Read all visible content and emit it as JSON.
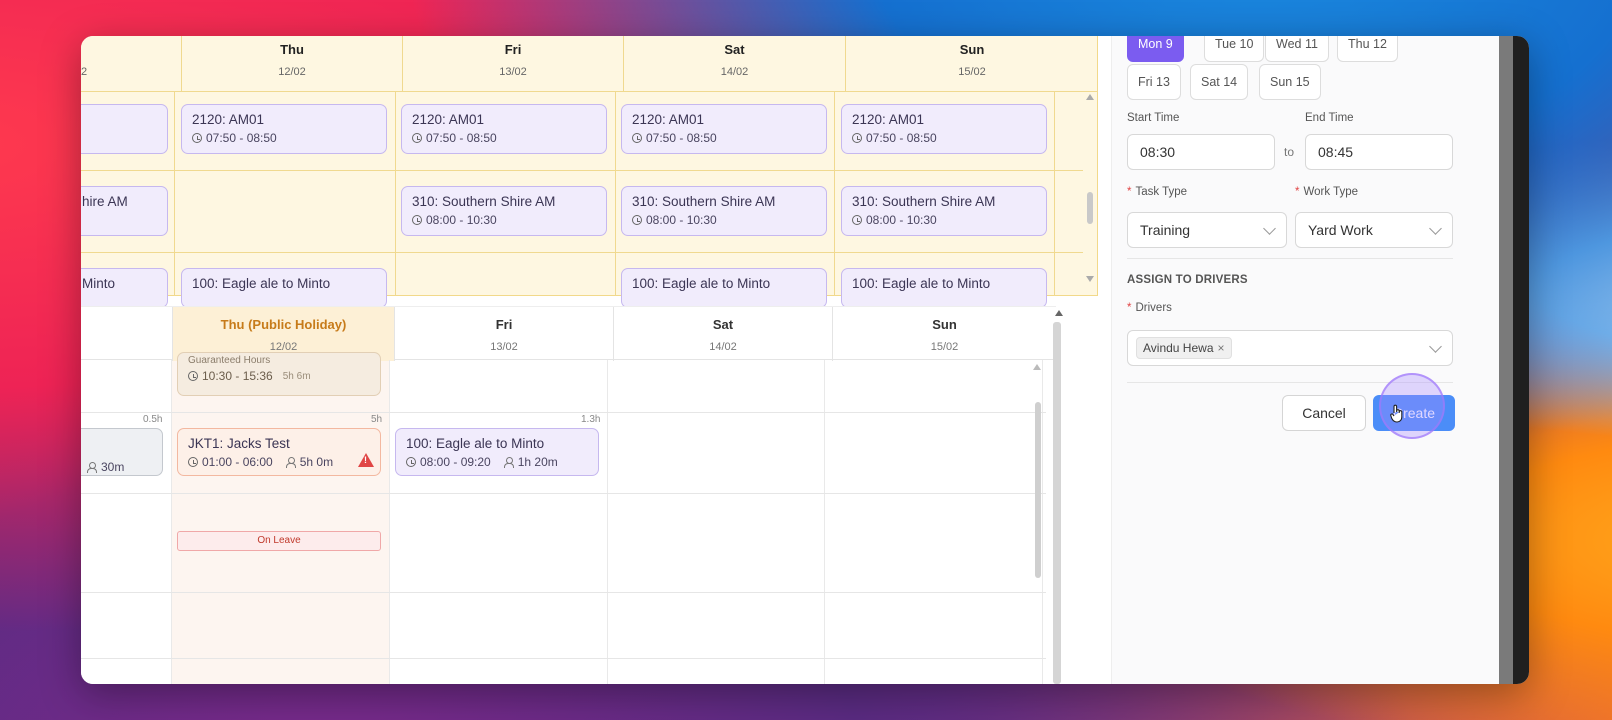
{
  "top_schedule": {
    "days": [
      {
        "name": "Thu",
        "date": "12/02"
      },
      {
        "name": "Fri",
        "date": "13/02"
      },
      {
        "name": "Sat",
        "date": "14/02"
      },
      {
        "name": "Sun",
        "date": "15/02"
      }
    ],
    "cut_date": "2",
    "row1": {
      "title": "2120: AM01",
      "time": "07:50 - 08:50"
    },
    "row2": {
      "title": "310: Southern Shire AM",
      "time": "08:00 - 10:30",
      "cut_title": "hire AM"
    },
    "row3": {
      "title": "100: Eagle ale to Minto",
      "cut_title": "Minto"
    }
  },
  "bottom_schedule": {
    "days": [
      {
        "name": "Thu (Public Holiday)",
        "date": "12/02"
      },
      {
        "name": "Fri",
        "date": "13/02"
      },
      {
        "name": "Sat",
        "date": "14/02"
      },
      {
        "name": "Sun",
        "date": "15/02"
      }
    ],
    "guaranteed_card": {
      "title": "Guaranteed Hours",
      "time": "10:30 - 15:36",
      "duration": "5h 6m"
    },
    "row_hours": {
      "col0": "0.5h",
      "thu": "5h",
      "fri": "1.3h"
    },
    "partial_card": {
      "duration": "30m"
    },
    "jacks_card": {
      "title": "JKT1: Jacks Test",
      "time": "01:00 - 06:00",
      "duration": "5h 0m",
      "warning": "!"
    },
    "eagle_card": {
      "title": "100: Eagle ale to Minto",
      "time": "08:00 - 09:20",
      "duration": "1h 20m"
    },
    "on_leave": "On Leave"
  },
  "form": {
    "day_chips": [
      "Mon 9",
      "Tue 10",
      "Wed 11",
      "Thu 12",
      "Fri 13",
      "Sat 14",
      "Sun 15"
    ],
    "selected_day": "Mon 9",
    "start_time_label": "Start Time",
    "end_time_label": "End Time",
    "start_time": "08:30",
    "end_time": "08:45",
    "to_label": "to",
    "required_mark": "*",
    "task_type_label": "Task Type",
    "task_type_value": "Training",
    "work_type_label": "Work Type",
    "work_type_value": "Yard Work",
    "assign_section": "ASSIGN TO DRIVERS",
    "drivers_label": "Drivers",
    "driver_tag": "Avindu Hewa",
    "tag_remove": "×",
    "cancel_label": "Cancel",
    "create_label": "Create"
  }
}
